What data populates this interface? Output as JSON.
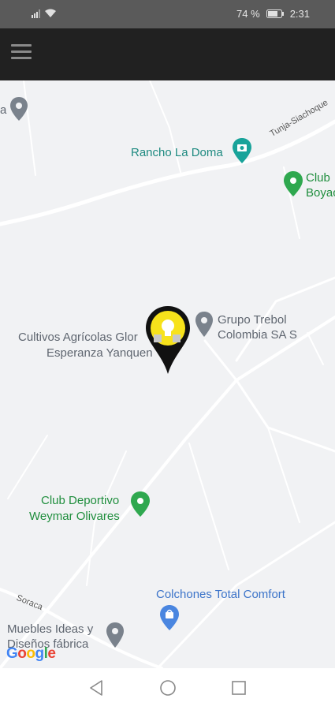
{
  "status_bar": {
    "battery": "74 %",
    "time": "2:31"
  },
  "map": {
    "places": {
      "rancho": "Rancho La Doma",
      "club_top": "Club",
      "club_top_2": "Boyac",
      "grupo_1": "Grupo Trebol",
      "grupo_2": "Colombia SA S",
      "cultivos_1": "Cultivos Agrícolas Glor",
      "cultivos_2": "Esperanza Yanquen",
      "club_dep_1": "Club Deportivo",
      "club_dep_2": "Weymar Olivares",
      "colchones": "Colchones Total Comfort",
      "muebles_1": "Muebles Ideas y",
      "muebles_2": "Diseños fábrica",
      "a_label": "a"
    },
    "roads": {
      "tunja": "Tunja-Siachoque",
      "soraca": "Soraca"
    },
    "attribution": "Google"
  },
  "colors": {
    "marker_fill": "#f7e21b",
    "marker_outline": "#111111",
    "app_bar": "#212121"
  }
}
